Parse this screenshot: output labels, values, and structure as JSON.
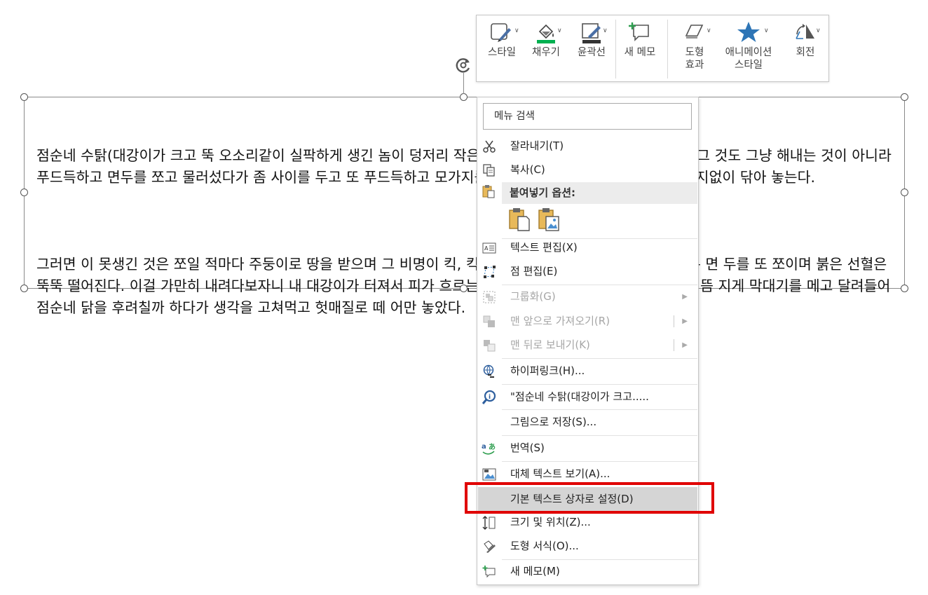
{
  "textbox": {
    "paragraphs": [
      "점순네 수탉(대강이가 크고 뚝 오소리같이 실팍하게 생긴 놈이 덩저리 작은 우리 수탉을 함부로 해내는 것이다. 그 것도 그냥 해내는 것이 아니라 푸드득하고 면두를 쪼고 물러섰다가 좀 사이를 두고 또 푸드득하고 모가지를 쪼았다. 이 렇게 멋을 부려 가며 여지없이 닦아 놓는다.",
      "그러면 이 못생긴 것은 쪼일 적마다 주둥이로 땅을 받으며 그 비명이 킥, 킥, 할 뿐이다. 물론 미처 아물지도 않은 면 두를 또 쪼이며 붉은 선혈은 뚝뚝 떨어진다. 이걸 가만히 내려다보자니 내 대강이가 터져서 피가 흐르는 것같이 두눈 에서 불이 번쩍 난다. 대뜸 지게 막대기를 메고 달려들어 점순네 닭을 후려칠까 하다가 생각을 고쳐먹고 헛매질로 떼 어만 놓았다."
    ]
  },
  "mini_toolbar": {
    "style": "스타일",
    "fill": "채우기",
    "outline": "윤곽선",
    "new_comment": "새 메모",
    "effects_1": "도형",
    "effects_2": "효과",
    "anim_1": "애니메이션",
    "anim_2": "스타일",
    "rotate": "회전",
    "colors": {
      "fill_bar": "#00b050",
      "outline_bar": "#333333",
      "star": "#2e75b6"
    }
  },
  "context_menu": {
    "search_placeholder": "메뉴 검색",
    "cut": "잘라내기(T)",
    "copy": "복사(C)",
    "paste_options": "붙여넣기 옵션:",
    "edit_text": "텍스트 편집(X)",
    "edit_points": "점 편집(E)",
    "group": "그룹화(G)",
    "bring_front": "맨 앞으로 가져오기(R)",
    "send_back": "맨 뒤로 보내기(K)",
    "hyperlink": "하이퍼링크(H)...",
    "smart_lookup": "\"점순네 수탉(대강이가 크고.....",
    "save_as_picture": "그림으로 저장(S)...",
    "translate": "번역(S)",
    "alt_text": "대체 텍스트 보기(A)...",
    "set_default": "기본 텍스트 상자로 설정(D)",
    "size_position": "크기 및 위치(Z)...",
    "format_shape": "도형 서식(O)...",
    "new_comment": "새 메모(M)"
  },
  "highlight_color": "#e00000"
}
